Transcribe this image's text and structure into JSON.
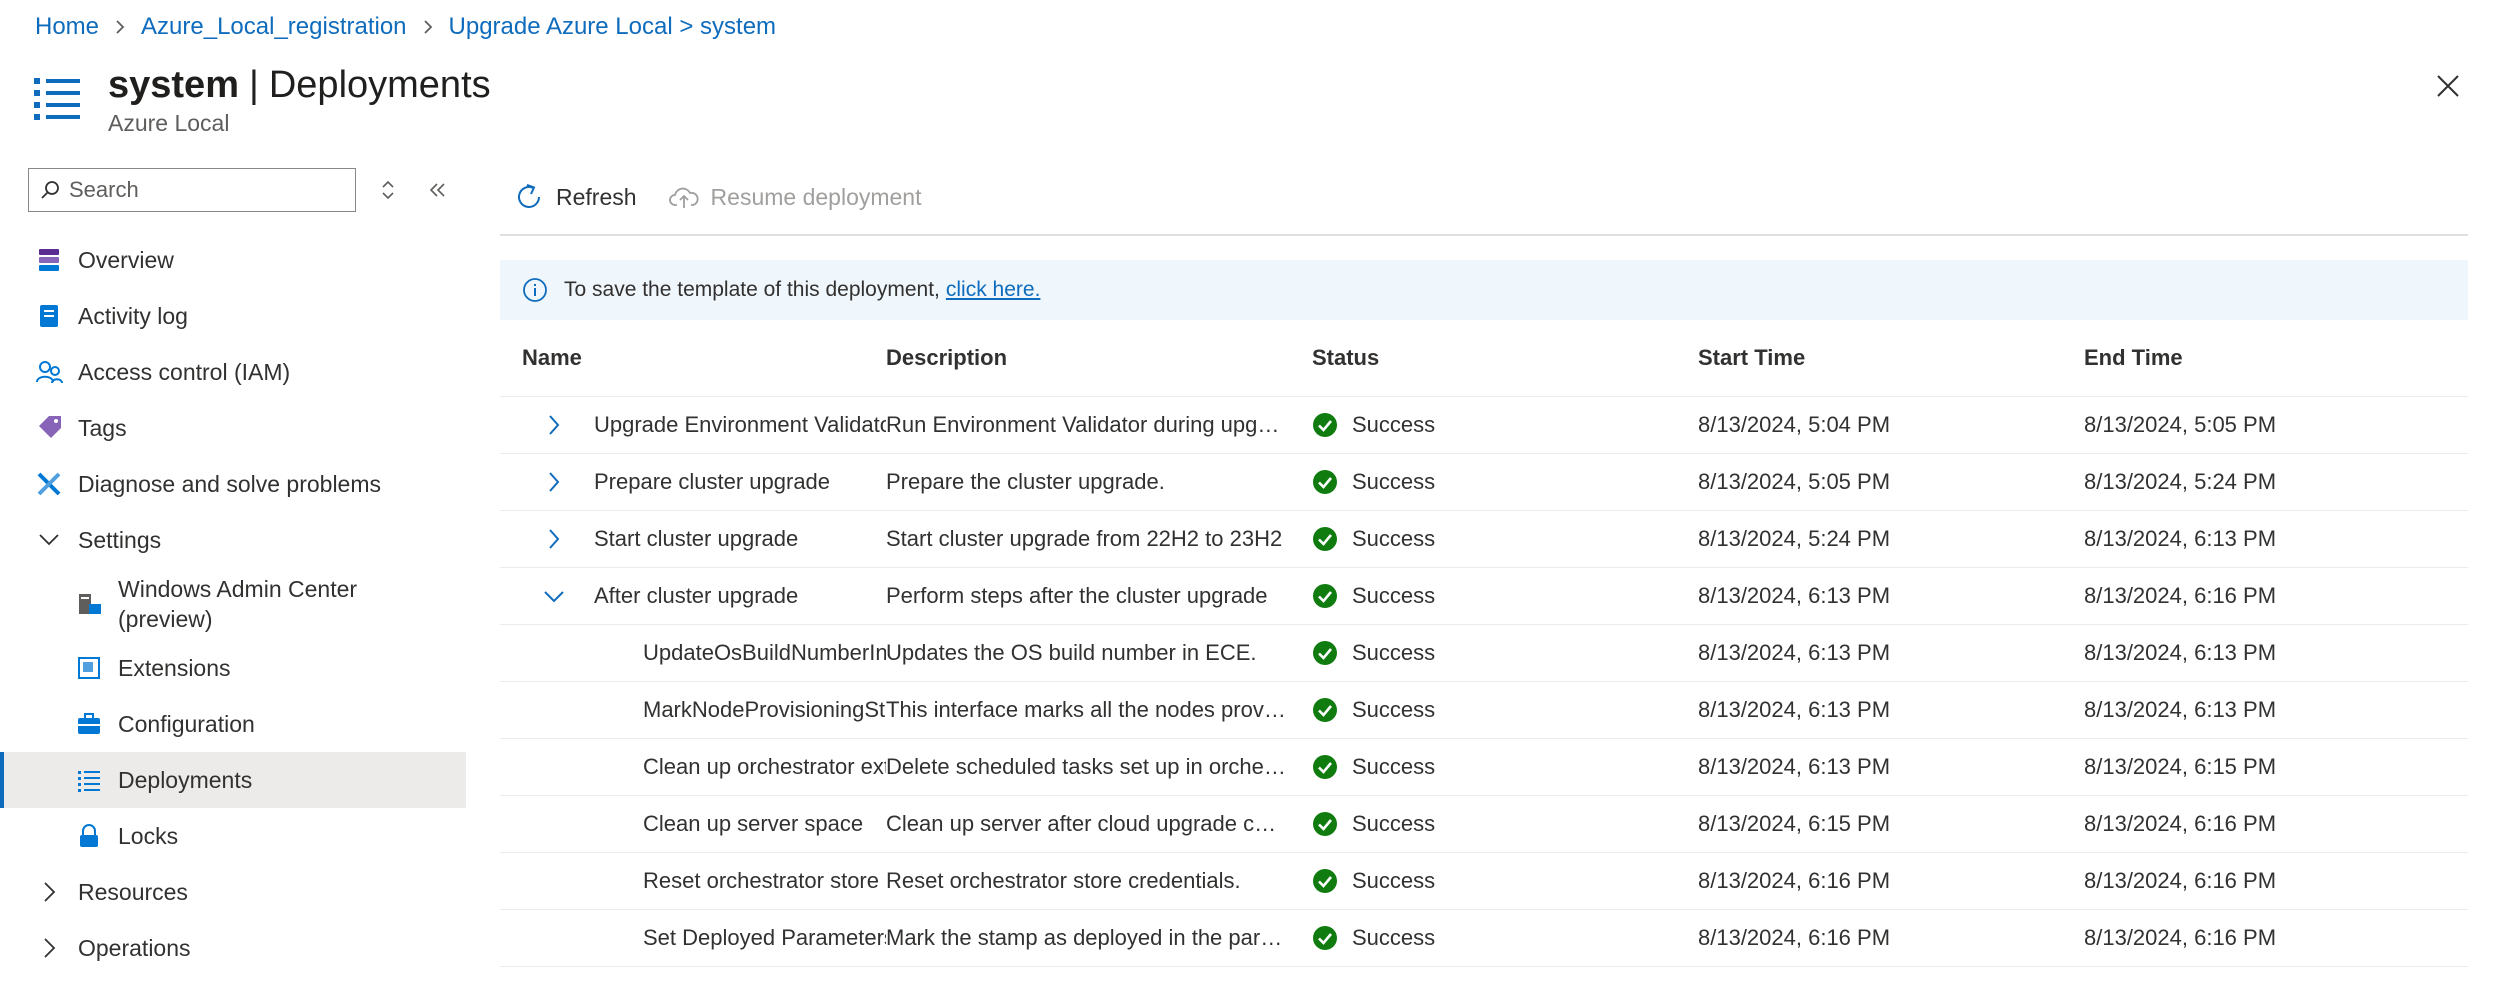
{
  "breadcrumb": {
    "items": [
      "Home",
      "Azure_Local_registration",
      "Upgrade Azure Local > system"
    ]
  },
  "header": {
    "resource_name": "system",
    "separator": "|",
    "page": "Deployments",
    "subtitle": "Azure Local"
  },
  "sidebar": {
    "search_placeholder": "Search",
    "items": [
      {
        "label": "Overview",
        "icon": "overview-icon"
      },
      {
        "label": "Activity log",
        "icon": "activity-log-icon"
      },
      {
        "label": "Access control (IAM)",
        "icon": "iam-icon"
      },
      {
        "label": "Tags",
        "icon": "tag-icon"
      },
      {
        "label": "Diagnose and solve problems",
        "icon": "wrench-icon"
      },
      {
        "label": "Settings",
        "icon": "chevron-down-icon"
      },
      {
        "label": "Windows Admin Center (preview)",
        "label_line1": "Windows Admin Center",
        "label_line2": "(preview)",
        "icon": "admin-center-icon"
      },
      {
        "label": "Extensions",
        "icon": "extensions-icon"
      },
      {
        "label": "Configuration",
        "icon": "configuration-icon"
      },
      {
        "label": "Deployments",
        "icon": "deployments-icon",
        "active": true
      },
      {
        "label": "Locks",
        "icon": "lock-icon"
      },
      {
        "label": "Resources",
        "icon": "chevron-right-icon"
      },
      {
        "label": "Operations",
        "icon": "chevron-right-icon"
      }
    ]
  },
  "toolbar": {
    "refresh_label": "Refresh",
    "resume_label": "Resume deployment"
  },
  "info": {
    "text": "To save the template of this deployment,",
    "link": "click here."
  },
  "table": {
    "columns": [
      "Name",
      "Description",
      "Status",
      "Start Time",
      "End Time"
    ],
    "rows": [
      {
        "name": "Upgrade Environment Validator",
        "desc": "Run Environment Validator during upgrade",
        "status": "Success",
        "start": "8/13/2024, 5:04 PM",
        "end": "8/13/2024, 5:05 PM",
        "level": 0,
        "expanded": false
      },
      {
        "name": "Prepare cluster upgrade",
        "desc": "Prepare the cluster upgrade.",
        "status": "Success",
        "start": "8/13/2024, 5:05 PM",
        "end": "8/13/2024, 5:24 PM",
        "level": 0,
        "expanded": false
      },
      {
        "name": "Start cluster upgrade",
        "desc": "Start cluster upgrade from 22H2 to 23H2",
        "status": "Success",
        "start": "8/13/2024, 5:24 PM",
        "end": "8/13/2024, 6:13 PM",
        "level": 0,
        "expanded": false
      },
      {
        "name": "After cluster upgrade",
        "desc": "Perform steps after the cluster upgrade",
        "status": "Success",
        "start": "8/13/2024, 6:13 PM",
        "end": "8/13/2024, 6:16 PM",
        "level": 0,
        "expanded": true
      },
      {
        "name": "UpdateOsBuildNumberInECE",
        "desc": "Updates the OS build number in ECE.",
        "status": "Success",
        "start": "8/13/2024, 6:13 PM",
        "end": "8/13/2024, 6:13 PM",
        "level": 1
      },
      {
        "name": "MarkNodeProvisioningState",
        "desc": "This interface marks all the nodes provisioned",
        "status": "Success",
        "start": "8/13/2024, 6:13 PM",
        "end": "8/13/2024, 6:13 PM",
        "level": 1
      },
      {
        "name": "Clean up orchestrator extension",
        "desc": "Delete scheduled tasks set up in orchestrator",
        "status": "Success",
        "start": "8/13/2024, 6:13 PM",
        "end": "8/13/2024, 6:15 PM",
        "level": 1
      },
      {
        "name": "Clean up server space",
        "desc": "Clean up server after cloud upgrade completes",
        "status": "Success",
        "start": "8/13/2024, 6:15 PM",
        "end": "8/13/2024, 6:16 PM",
        "level": 1
      },
      {
        "name": "Reset orchestrator store",
        "desc": "Reset orchestrator store credentials.",
        "status": "Success",
        "start": "8/13/2024, 6:16 PM",
        "end": "8/13/2024, 6:16 PM",
        "level": 1
      },
      {
        "name": "Set Deployed Parameters",
        "desc": "Mark the stamp as deployed in the parameters",
        "status": "Success",
        "start": "8/13/2024, 6:16 PM",
        "end": "8/13/2024, 6:16 PM",
        "level": 1
      }
    ]
  },
  "colors": {
    "accent": "#0f6cbd",
    "success": "#107c10",
    "info_bg": "#eff6fc",
    "active_bg": "#edebe9"
  }
}
